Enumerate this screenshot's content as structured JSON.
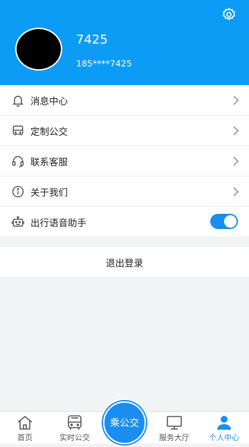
{
  "header": {
    "username": "7425",
    "phone": "185****7425",
    "settings_icon": "gear-icon",
    "background_color": "#0d9cf5"
  },
  "menu": {
    "items": [
      {
        "label": "消息中心",
        "icon": "bell-icon",
        "type": "link"
      },
      {
        "label": "定制公交",
        "icon": "bus-icon",
        "type": "link"
      },
      {
        "label": "联系客服",
        "icon": "headset-icon",
        "type": "link"
      },
      {
        "label": "关于我们",
        "icon": "info-icon",
        "type": "link"
      },
      {
        "label": "出行语音助手",
        "icon": "robot-icon",
        "type": "toggle",
        "enabled": true
      }
    ]
  },
  "logout": {
    "label": "退出登录"
  },
  "tabbar": {
    "tabs": [
      {
        "label": "首页",
        "icon": "home-icon",
        "active": false
      },
      {
        "label": "实时公交",
        "icon": "bus-front-icon",
        "active": false
      },
      {
        "label": "乘公交",
        "icon": "ride-bus-button",
        "active": false
      },
      {
        "label": "服务大厅",
        "icon": "monitor-icon",
        "active": false
      },
      {
        "label": "个人中心",
        "icon": "user-icon",
        "active": true
      }
    ],
    "accent_color": "#1a8df0"
  }
}
